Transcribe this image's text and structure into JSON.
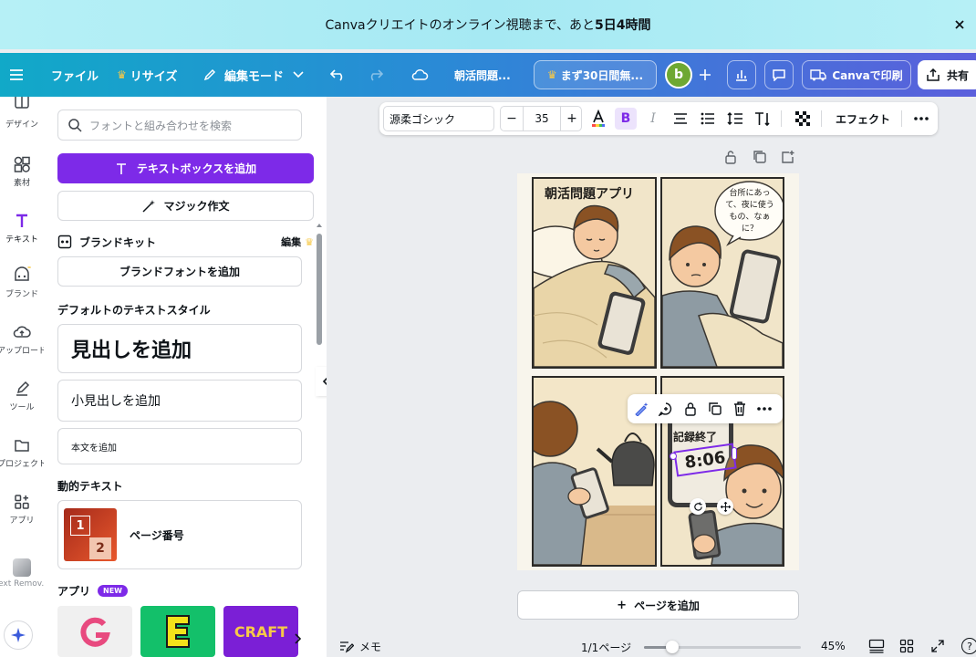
{
  "banner": {
    "text_prefix": "Canvaクリエイトのオンライン視聴まで、あと",
    "text_bold": "5日4時間"
  },
  "topbar": {
    "file": "ファイル",
    "resize": "リサイズ",
    "edit_mode": "編集モード",
    "doc_title": "朝活問題...",
    "promo": "まず30日間無...",
    "avatar_letter": "b",
    "print": "Canvaで印刷",
    "share": "共有"
  },
  "rail": {
    "items": [
      "デザイン",
      "素材",
      "テキスト",
      "ブランド",
      "アップロード",
      "ツール",
      "プロジェクト",
      "アプリ",
      "Text Remov..."
    ]
  },
  "panel": {
    "search_placeholder": "フォントと組み合わせを検索",
    "add_textbox": "テキストボックスを追加",
    "magic_write": "マジック作文",
    "brand_kit": "ブランドキット",
    "brand_edit": "編集",
    "add_brand_font": "ブランドフォントを追加",
    "default_styles": "デフォルトのテキストスタイル",
    "heading": "見出しを追加",
    "subheading": "小見出しを追加",
    "body": "本文を追加",
    "dynamic_text": "動的テキスト",
    "page_number": "ページ番号",
    "page_number_thumb_1": "1",
    "page_number_thumb_2": "2",
    "apps": "アプリ",
    "new_badge": "NEW",
    "app_thumb_3": "CRAFT"
  },
  "toolbar": {
    "font": "源柔ゴシック",
    "size": "35",
    "bold": "B",
    "italic": "I",
    "effects": "エフェクト"
  },
  "comic": {
    "title": "朝活問題アプリ",
    "bubble": "台所にあっ\nて、夜に使う\nもの、なぁ\nに？",
    "record_end": "記録終了",
    "time": "8:06"
  },
  "canvas": {
    "add_page": "ページを追加"
  },
  "footer": {
    "memo": "メモ",
    "page_indicator": "1/1ページ",
    "zoom_value": 45,
    "zoom": "45%"
  },
  "colors": {
    "accent_purple": "#7d2ae8",
    "banner_bg": "#b6f0f6",
    "topbar_start": "#11a9c8",
    "topbar_end": "#5b5fdc"
  }
}
